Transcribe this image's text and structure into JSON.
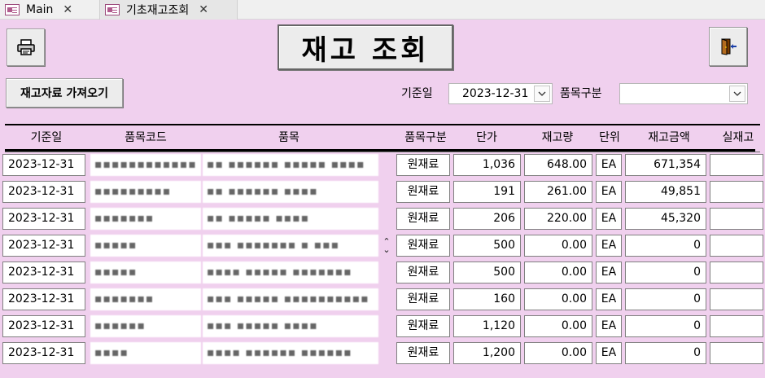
{
  "tabs": [
    {
      "label": "Main",
      "close": "✕"
    },
    {
      "label": "기초재고조회",
      "close": "✕"
    }
  ],
  "header": {
    "title": "재고 조회",
    "load_button": "재고자료 가져오기",
    "print_icon": "printer-icon",
    "exit_icon": "exit-door-icon"
  },
  "filters": {
    "date_label": "기준일",
    "date_value": "2023-12-31",
    "category_label": "품목구분",
    "category_value": ""
  },
  "columns": [
    "기준일",
    "품목코드",
    "품목",
    "품목구분",
    "단가",
    "재고량",
    "단위",
    "재고금액",
    "실재고"
  ],
  "rows": [
    {
      "date": "2023-12-31",
      "code": "▪▪▪▪▪▪▪▪▪▪▪▪",
      "item": "▪▪ ▪▪▪▪▪▪ ▪▪▪▪▪ ▪▪▪▪",
      "cat": "원재료",
      "price": "1,036",
      "qty": "648.00",
      "unit": "EA",
      "amount": "671,354"
    },
    {
      "date": "2023-12-31",
      "code": "▪▪▪▪▪▪▪▪▪",
      "item": "▪▪ ▪▪▪▪▪▪ ▪▪▪▪",
      "cat": "원재료",
      "price": "191",
      "qty": "261.00",
      "unit": "EA",
      "amount": "49,851"
    },
    {
      "date": "2023-12-31",
      "code": "▪▪▪▪▪▪▪",
      "item": "▪▪ ▪▪▪▪▪ ▪▪▪▪",
      "cat": "원재료",
      "price": "206",
      "qty": "220.00",
      "unit": "EA",
      "amount": "45,320"
    },
    {
      "date": "2023-12-31",
      "code": "▪▪▪▪▪",
      "item": "▪▪▪ ▪▪▪▪▪▪▪ ▪ ▪▪▪",
      "cat": "원재료",
      "price": "500",
      "qty": "0.00",
      "unit": "EA",
      "amount": "0"
    },
    {
      "date": "2023-12-31",
      "code": "▪▪▪▪▪",
      "item": "▪▪▪▪ ▪▪▪▪▪ ▪▪▪▪▪▪▪",
      "cat": "원재료",
      "price": "500",
      "qty": "0.00",
      "unit": "EA",
      "amount": "0"
    },
    {
      "date": "2023-12-31",
      "code": "▪▪▪▪▪▪▪",
      "item": "▪▪▪ ▪▪▪▪▪ ▪▪▪▪▪▪▪▪▪▪",
      "cat": "원재료",
      "price": "160",
      "qty": "0.00",
      "unit": "EA",
      "amount": "0"
    },
    {
      "date": "2023-12-31",
      "code": "▪▪▪▪▪▪",
      "item": "▪▪▪ ▪▪▪▪▪ ▪▪▪▪",
      "cat": "원재료",
      "price": "1,120",
      "qty": "0.00",
      "unit": "EA",
      "amount": "0"
    },
    {
      "date": "2023-12-31",
      "code": "▪▪▪▪",
      "item": "▪▪▪▪ ▪▪▪▪▪▪ ▪▪▪▪▪▪",
      "cat": "원재료",
      "price": "1,200",
      "qty": "0.00",
      "unit": "EA",
      "amount": "0"
    }
  ]
}
